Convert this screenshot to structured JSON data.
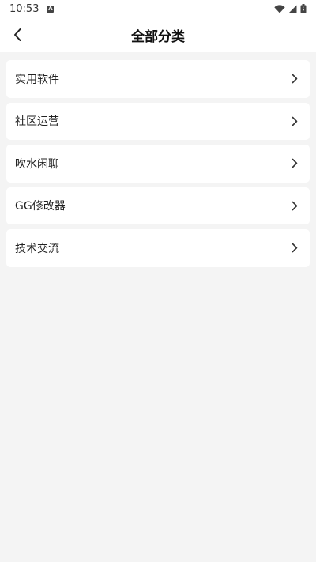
{
  "status_bar": {
    "time": "10:53",
    "notification_icon_letter": "A"
  },
  "header": {
    "title": "全部分类"
  },
  "categories": [
    {
      "label": "实用软件"
    },
    {
      "label": "社区运营"
    },
    {
      "label": "吹水闲聊"
    },
    {
      "label": "GG修改器"
    },
    {
      "label": "技术交流"
    }
  ],
  "icons": {
    "back": "back-arrow-icon",
    "row_chevron": "chevron-right-icon",
    "wifi": "wifi-icon",
    "signal": "signal-icon",
    "battery": "battery-icon"
  }
}
